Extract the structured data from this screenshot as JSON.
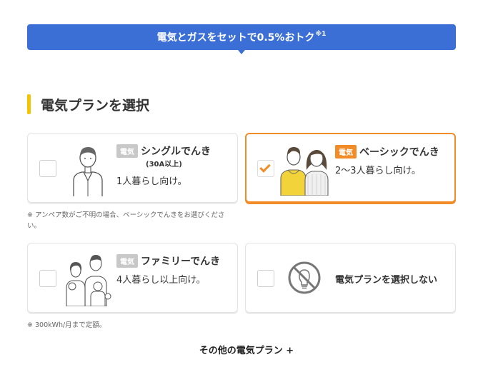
{
  "banner": {
    "text": "電気とガスをセットで0.5%おトク",
    "note_mark": "※1"
  },
  "section": {
    "title": "電気プランを選択"
  },
  "plans": [
    {
      "badge": "電気",
      "name": "シングルでんき",
      "sub": "(30A以上)",
      "desc": "1人暮らし向け。",
      "selected": false
    },
    {
      "badge": "電気",
      "name": "ベーシックでんき",
      "desc": "2〜3人暮らし向け。",
      "selected": true
    },
    {
      "badge": "電気",
      "name": "ファミリーでんき",
      "desc": "4人暮らし以上向け。",
      "selected": false
    },
    {
      "label": "電気プランを選択しない",
      "selected": false
    }
  ],
  "notes": {
    "ampere": "※ アンペア数がご不明の場合、ベーシックでんきをお選びください。",
    "fixed": "※ 300kWh/月まで定額。"
  },
  "more_link": "その他の電気プラン +",
  "colors": {
    "banner": "#3b6fd6",
    "accent": "#f28c28",
    "section_bar": "#f5c400"
  },
  "icons": [
    "person-icon",
    "couple-icon",
    "family-icon",
    "no-bulb-icon",
    "checkmark-icon"
  ]
}
